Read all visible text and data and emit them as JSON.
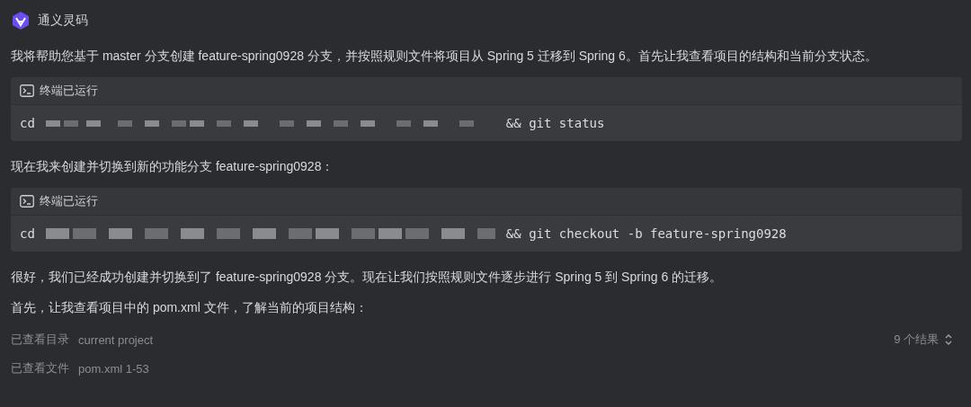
{
  "header": {
    "title": "通义灵码"
  },
  "blocks": [
    {
      "kind": "text",
      "text": "我将帮助您基于 master 分支创建 feature-spring0928 分支，并按照规则文件将项目从 Spring 5 迁移到 Spring 6。首先让我查看项目的结构和当前分支状态。"
    },
    {
      "kind": "terminal",
      "label": "终端已运行",
      "prefix": "cd",
      "suffix": "&& git status"
    },
    {
      "kind": "text",
      "text": "现在我来创建并切换到新的功能分支 feature-spring0928："
    },
    {
      "kind": "terminal",
      "label": "终端已运行",
      "prefix": "cd",
      "suffix": "&& git checkout -b feature-spring0928"
    },
    {
      "kind": "text",
      "text": "很好，我们已经成功创建并切换到了 feature-spring0928 分支。现在让我们按照规则文件逐步进行 Spring 5 到 Spring 6 的迁移。"
    },
    {
      "kind": "text",
      "text": "首先，让我查看项目中的 pom.xml 文件，了解当前的项目结构："
    },
    {
      "kind": "status",
      "label": "已查看目录",
      "value": "current project",
      "result": "9 个结果"
    },
    {
      "kind": "status",
      "label": "已查看文件",
      "value": "pom.xml 1-53"
    }
  ]
}
